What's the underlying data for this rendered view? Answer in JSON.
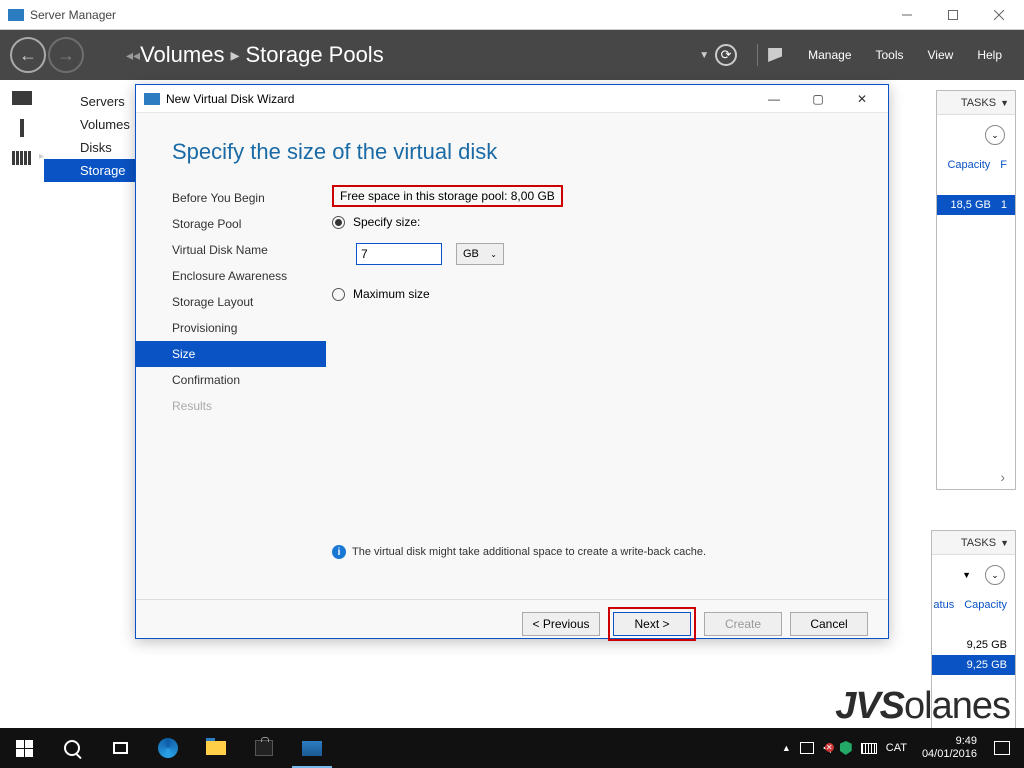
{
  "app": {
    "title": "Server Manager"
  },
  "header": {
    "crumb1": "Volumes",
    "crumb2": "Storage Pools",
    "menus": {
      "manage": "Manage",
      "tools": "Tools",
      "view": "View",
      "help": "Help"
    }
  },
  "sidenav": {
    "items": [
      {
        "label": "Servers"
      },
      {
        "label": "Volumes"
      },
      {
        "label": "Disks"
      },
      {
        "label": "Storage"
      }
    ]
  },
  "right_top": {
    "tasks": "TASKS",
    "cols": {
      "capacity": "Capacity",
      "f": "F"
    },
    "row": {
      "capacity": "18,5 GB",
      "f": "1"
    }
  },
  "right_bot": {
    "tasks": "TASKS",
    "th": {
      "status": "atus",
      "capacity": "Capacity"
    },
    "rows": [
      {
        "capacity": "9,25 GB"
      },
      {
        "capacity": "9,25 GB"
      }
    ]
  },
  "logo": "JVSolanes",
  "wizard": {
    "title": "New Virtual Disk Wizard",
    "heading": "Specify the size of the virtual disk",
    "steps": [
      "Before You Begin",
      "Storage Pool",
      "Virtual Disk Name",
      "Enclosure Awareness",
      "Storage Layout",
      "Provisioning",
      "Size",
      "Confirmation",
      "Results"
    ],
    "free_space": "Free space in this storage pool: 8,00 GB",
    "opt_specify": "Specify size:",
    "size_value": "7",
    "size_unit": "GB",
    "opt_max": "Maximum size",
    "info": "The virtual disk might take additional space to create a write-back cache.",
    "buttons": {
      "prev": "< Previous",
      "next": "Next >",
      "create": "Create",
      "cancel": "Cancel"
    }
  },
  "taskbar": {
    "lang": "CAT",
    "time": "9:49",
    "date": "04/01/2016"
  }
}
